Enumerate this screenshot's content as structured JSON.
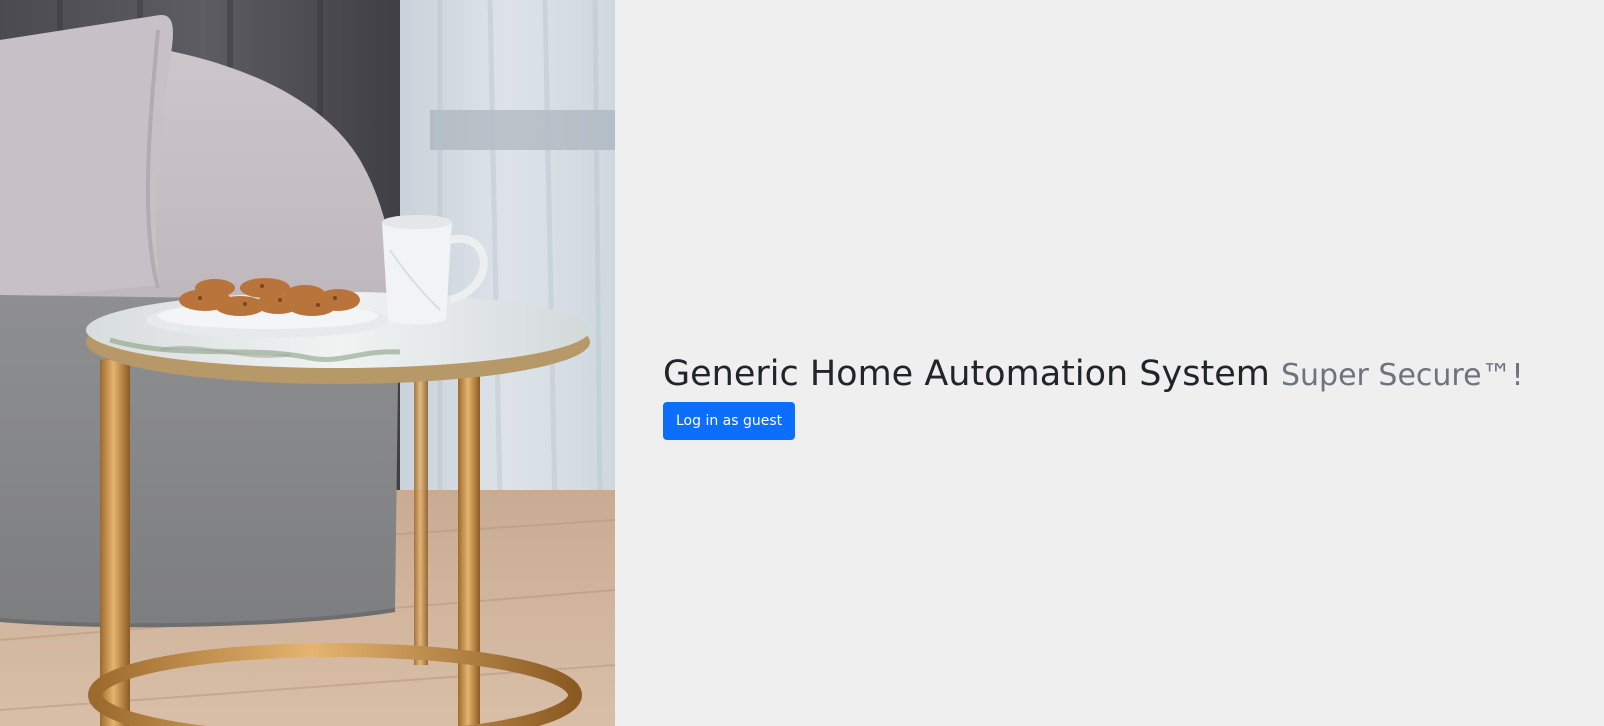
{
  "page": {
    "background": "#efefef"
  },
  "hero": {
    "image_name": "living-room-side-table-photo"
  },
  "heading": {
    "title": "Generic Home Automation System",
    "subtitle": "Super Secure™!"
  },
  "actions": {
    "guest_login_label": "Log in as guest",
    "button_color": "#0d6efd"
  },
  "colors": {
    "title": "#212529",
    "subtitle": "#6c757d"
  }
}
